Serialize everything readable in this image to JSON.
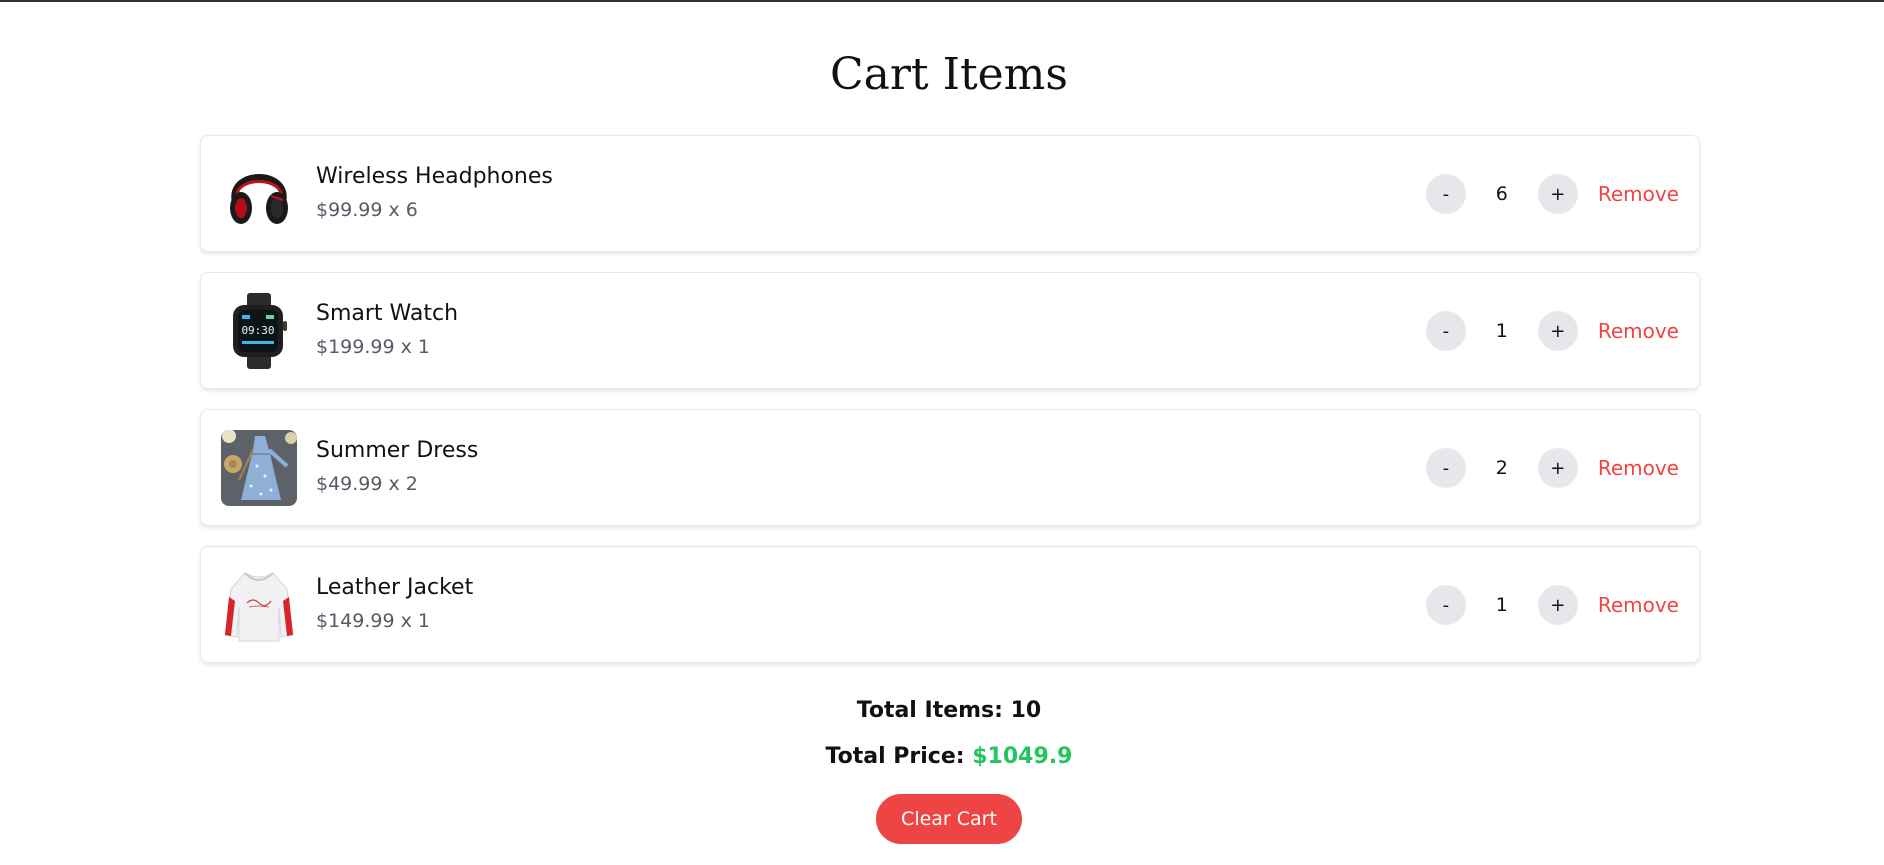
{
  "page": {
    "title": "Cart Items"
  },
  "items": [
    {
      "name": "Wireless Headphones",
      "price_text": "$99.99 x 6",
      "quantity": "6",
      "image_icon": "headphones-image"
    },
    {
      "name": "Smart Watch",
      "price_text": "$199.99 x 1",
      "quantity": "1",
      "image_icon": "smartwatch-image"
    },
    {
      "name": "Summer Dress",
      "price_text": "$49.99 x 2",
      "quantity": "2",
      "image_icon": "dress-image"
    },
    {
      "name": "Leather Jacket",
      "price_text": "$149.99 x 1",
      "quantity": "1",
      "image_icon": "jacket-image"
    }
  ],
  "controls": {
    "decrement_label": "-",
    "increment_label": "+",
    "remove_label": "Remove"
  },
  "summary": {
    "total_items_text": "Total Items: 10",
    "total_price_label": "Total Price:",
    "total_price_value": "$1049.9",
    "clear_cart_label": "Clear Cart"
  },
  "colors": {
    "remove": "#ef4444",
    "price_value": "#22c55e",
    "clear_button": "#ef4444",
    "qty_button_bg": "#e6e7ea"
  }
}
